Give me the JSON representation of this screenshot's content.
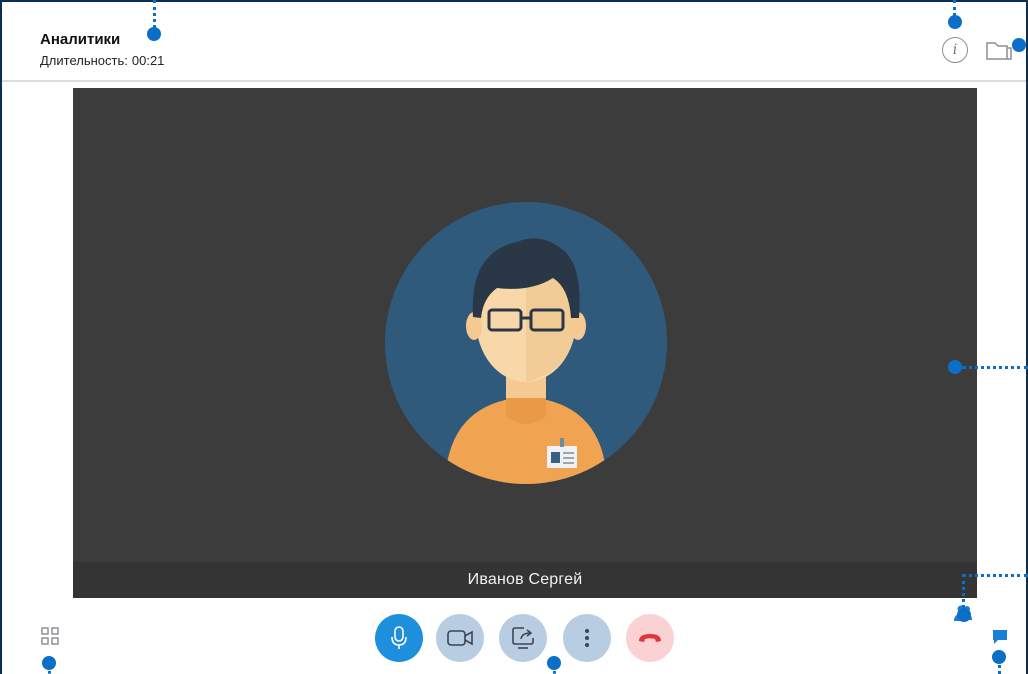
{
  "header": {
    "title": "Аналитики",
    "duration_label": "Длительность:",
    "duration_value": "00:21",
    "info_icon": "info-icon",
    "folder_icon": "folder-icon"
  },
  "video": {
    "participant_name": "Иванов Сергей",
    "avatar_icon": "user-avatar"
  },
  "toolbar": {
    "layout_icon": "grid-layout-icon",
    "buttons": [
      {
        "name": "microphone",
        "icon": "microphone-icon",
        "state": "active"
      },
      {
        "name": "camera",
        "icon": "video-camera-icon",
        "state": "inactive"
      },
      {
        "name": "screen-share",
        "icon": "screen-share-icon",
        "state": "inactive"
      },
      {
        "name": "more",
        "icon": "more-vertical-icon",
        "state": "inactive"
      },
      {
        "name": "end-call",
        "icon": "hang-up-icon",
        "state": "danger"
      }
    ],
    "participants_icon": "participants-icon",
    "chat_icon": "chat-icon"
  },
  "colors": {
    "accent": "#1e8fdc",
    "button_inactive": "#b8cde2",
    "hangup_bg": "#fbd2d4",
    "hangup_icon": "#e2353d",
    "video_bg": "#3c3c3c",
    "annotation": "#0b6fc7",
    "frame": "#0b2f55"
  }
}
